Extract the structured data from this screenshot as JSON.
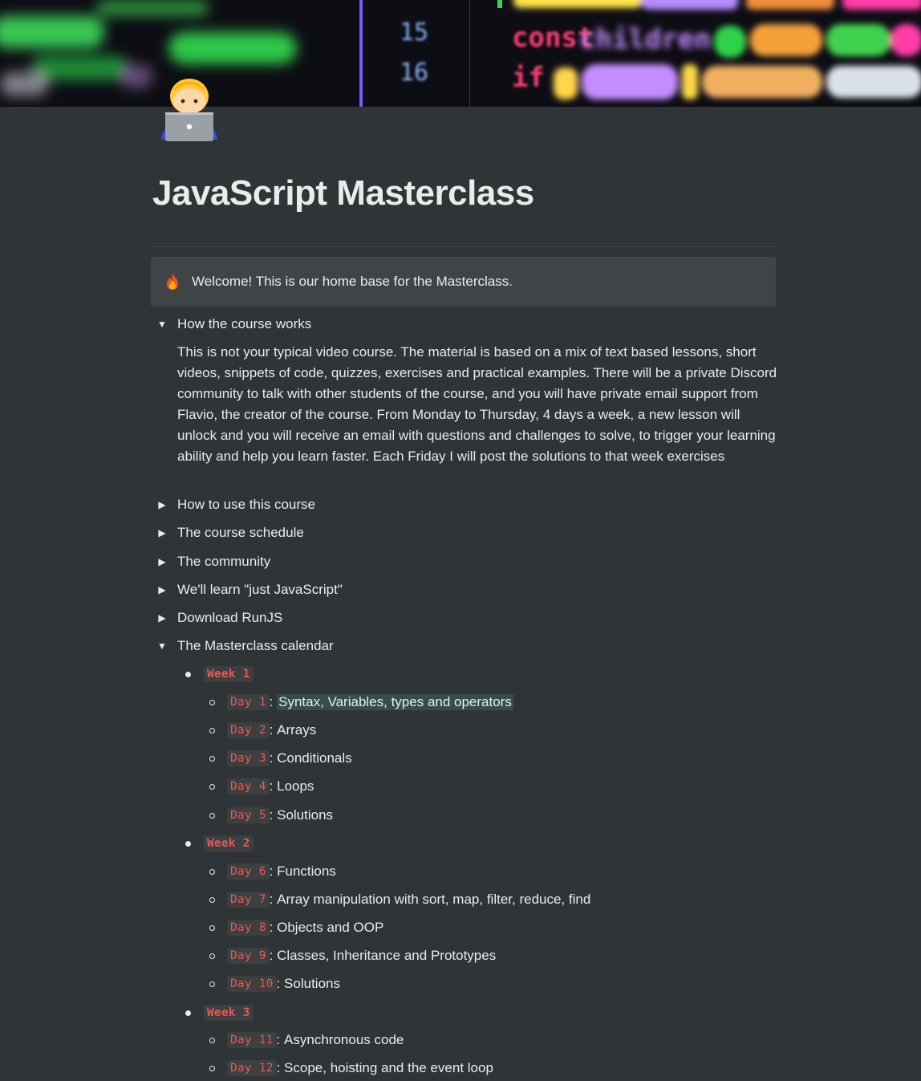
{
  "page": {
    "title": "JavaScript Masterclass",
    "icon": "technologist-emoji-icon",
    "cover": "code-editor-cover-image"
  },
  "cover_text": {
    "line15": "15",
    "line16": "16",
    "const": "const",
    "children": "children",
    "if": "if"
  },
  "callout": {
    "icon": "fire-icon",
    "text": "Welcome! This is our home base for the Masterclass."
  },
  "toggles": [
    {
      "label": "How the course works",
      "open": true,
      "body": "This is not your typical video course. The material is based on a mix of text based lessons, short videos, snippets of code, quizzes, exercises and practical examples. There will be a private Discord community to talk with other students of the course, and you will have private email support from Flavio, the creator of the course. From Monday to Thursday, 4 days a week, a new lesson will unlock and you will receive an email with questions and challenges to solve, to trigger your learning ability and help you learn faster. Each Friday I will post the solutions to that week exercises"
    },
    {
      "label": "How to use this course",
      "open": false
    },
    {
      "label": "The course schedule",
      "open": false
    },
    {
      "label": "The community",
      "open": false
    },
    {
      "label": "We'll learn \"just JavaScript\"",
      "open": false
    },
    {
      "label": "Download RunJS",
      "open": false
    },
    {
      "label": "The Masterclass calendar",
      "open": true
    }
  ],
  "calendar": {
    "weeks": [
      {
        "label": "Week 1",
        "days": [
          {
            "code": "Day 1",
            "topic": "Syntax, Variables, types and operators",
            "highlighted": true
          },
          {
            "code": "Day 2",
            "topic": "Arrays"
          },
          {
            "code": "Day 3",
            "topic": "Conditionals"
          },
          {
            "code": "Day 4",
            "topic": "Loops"
          },
          {
            "code": "Day 5",
            "topic": "Solutions"
          }
        ]
      },
      {
        "label": "Week 2",
        "days": [
          {
            "code": "Day 6",
            "topic": "Functions"
          },
          {
            "code": "Day 7",
            "topic": "Array manipulation with sort, map, filter, reduce, find"
          },
          {
            "code": "Day 8",
            "topic": "Objects and OOP"
          },
          {
            "code": "Day 9",
            "topic": "Classes, Inheritance and Prototypes"
          },
          {
            "code": "Day 10",
            "topic": "Solutions"
          }
        ]
      },
      {
        "label": "Week 3",
        "days": [
          {
            "code": "Day 11",
            "topic": "Asynchronous code"
          },
          {
            "code": "Day 12",
            "topic": "Scope, hoisting and the event loop"
          }
        ]
      }
    ],
    "separator": ": "
  },
  "colors": {
    "background": "#2f3437",
    "callout_bg": "#3f4447",
    "inline_code": "#eb5757",
    "highlight": "#3c5a52"
  }
}
